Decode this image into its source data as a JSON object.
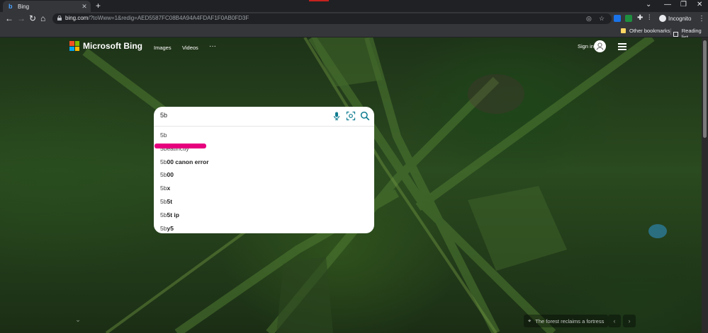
{
  "browser": {
    "tab_title": "Bing",
    "url_host": "bing.com",
    "url_path": "/?toWww=1&redig=AED5587FC08B4A94A4FDAF1F0AB0FD3F",
    "incognito_label": "Incognito",
    "bookmarks": {
      "other": "Other bookmarks",
      "reading": "Reading list"
    }
  },
  "bing": {
    "brand": "Microsoft Bing",
    "nav": [
      "Images",
      "Videos"
    ],
    "more": "···",
    "signin": "Sign in",
    "search_value": "5b",
    "suggestions": [
      {
        "prefix": "5b",
        "rest": ""
      },
      {
        "prefix": "5beatinctly",
        "rest": ""
      },
      {
        "prefix": "5b",
        "rest": "00 canon error"
      },
      {
        "prefix": "5b",
        "rest": "00"
      },
      {
        "prefix": "5b",
        "rest": "x"
      },
      {
        "prefix": "5b",
        "rest": "5t"
      },
      {
        "prefix": "5b",
        "rest": "5t ip"
      },
      {
        "prefix": "5b",
        "rest": "y5"
      }
    ],
    "image_caption": "The forest reclaims a fortress"
  },
  "colors": {
    "bing_teal": "#0f7c90",
    "highlight": "#e6007e"
  }
}
